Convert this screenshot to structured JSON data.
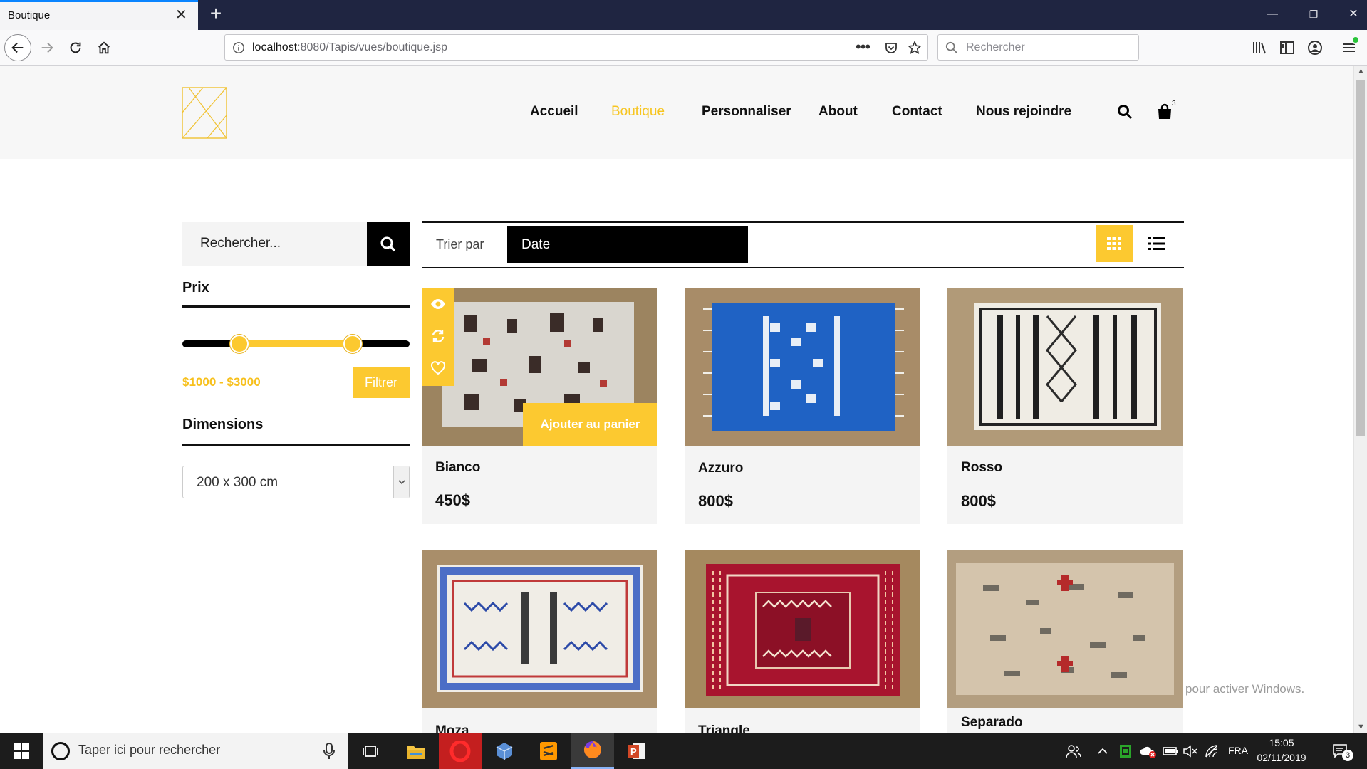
{
  "browser": {
    "tab_title": "Boutique",
    "url_host": "localhost",
    "url_rest": ":8080/Tapis/vues/boutique.jsp",
    "search_placeholder": "Rechercher"
  },
  "site": {
    "menu": [
      {
        "label": "Accueil",
        "active": false
      },
      {
        "label": "Boutique",
        "active": true
      },
      {
        "label": "Personnaliser",
        "active": false
      },
      {
        "label": "About",
        "active": false
      },
      {
        "label": "Contact",
        "active": false
      },
      {
        "label": "Nous rejoindre",
        "active": false
      }
    ],
    "cart_count": "3",
    "accent_color": "#fcc930"
  },
  "sidebar": {
    "search_placeholder": "Rechercher...",
    "price_title": "Prix",
    "price_range": "$1000 - $3000",
    "price_min": 1000,
    "price_max": 3000,
    "filter_button": "Filtrer",
    "dimensions_title": "Dimensions",
    "dimensions_value": "200 x 300 cm"
  },
  "toolbar": {
    "sort_label": "Trier par",
    "sort_value": "Date"
  },
  "products": [
    {
      "name": "Bianco",
      "price": "450$",
      "add_to_cart": "Ajouter au panier",
      "rug": "white"
    },
    {
      "name": "Azzuro",
      "price": "800$",
      "rug": "blue"
    },
    {
      "name": "Rosso",
      "price": "800$",
      "rug": "stripes"
    },
    {
      "name": "Moza",
      "price": "",
      "rug": "moza"
    },
    {
      "name": "Triangle",
      "price": "",
      "rug": "red"
    },
    {
      "name": "Separado",
      "price": "",
      "rug": "beige"
    }
  ],
  "watermark": "pour activer Windows.",
  "taskbar": {
    "search_placeholder": "Taper ici pour rechercher",
    "language": "FRA",
    "time": "15:05",
    "date": "02/11/2019",
    "notifications": "3"
  }
}
